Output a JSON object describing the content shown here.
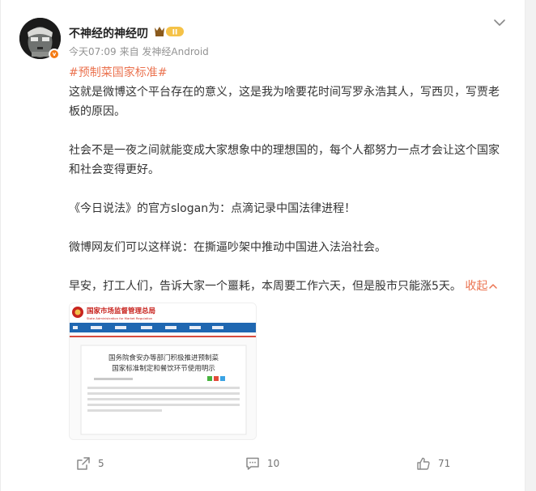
{
  "post": {
    "username": "不神经的神经叨",
    "badge_level": "II",
    "verified_mark": "v",
    "time": "今天07:09",
    "source": "来自 发神经Android",
    "hashtag": "#预制菜国家标准#",
    "paragraphs": [
      "这就是微博这个平台存在的意义，这是我为啥要花时间写罗永浩其人，写西贝，写贾老板的原因。",
      "社会不是一夜之间就能变成大家想象中的理想国的，每个人都努力一点才会让这个国家和社会变得更好。",
      "《今日说法》的官方slogan为：点滴记录中国法律进程！",
      "微博网友们可以这样说：在撕逼吵架中推动中国进入法治社会。"
    ],
    "last_paragraph": "早安，打工人们，告诉大家一个噩耗，本周要工作六天，但是股市只能涨5天。",
    "collapse_label": "收起",
    "accent_color": "#eb7350"
  },
  "image": {
    "site_name": "国家市场监督管理总局",
    "site_name_en": "State Administration for Market Regulation",
    "headline_1": "国务院食安办等部门积极推进预制菜",
    "headline_2": "国家标准制定和餐饮环节使用明示"
  },
  "actions": {
    "repost_icon": "share-icon",
    "repost_count": "5",
    "comment_icon": "comment-icon",
    "comment_count": "10",
    "like_icon": "thumbs-up-icon",
    "like_count": "71"
  }
}
